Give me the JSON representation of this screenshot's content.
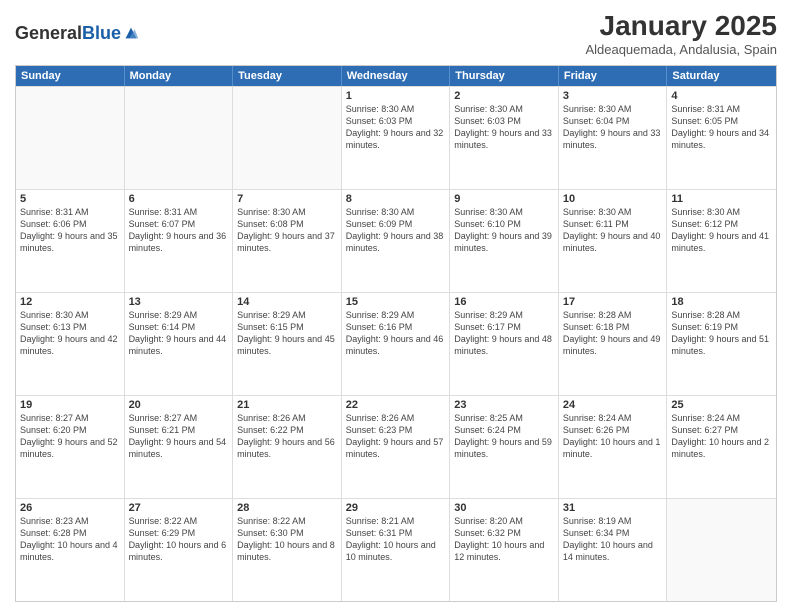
{
  "logo": {
    "general": "General",
    "blue": "Blue"
  },
  "header": {
    "month": "January 2025",
    "location": "Aldeaquemada, Andalusia, Spain"
  },
  "weekdays": [
    "Sunday",
    "Monday",
    "Tuesday",
    "Wednesday",
    "Thursday",
    "Friday",
    "Saturday"
  ],
  "weeks": [
    [
      {
        "day": "",
        "sunrise": "",
        "sunset": "",
        "daylight": ""
      },
      {
        "day": "",
        "sunrise": "",
        "sunset": "",
        "daylight": ""
      },
      {
        "day": "",
        "sunrise": "",
        "sunset": "",
        "daylight": ""
      },
      {
        "day": "1",
        "sunrise": "Sunrise: 8:30 AM",
        "sunset": "Sunset: 6:03 PM",
        "daylight": "Daylight: 9 hours and 32 minutes."
      },
      {
        "day": "2",
        "sunrise": "Sunrise: 8:30 AM",
        "sunset": "Sunset: 6:03 PM",
        "daylight": "Daylight: 9 hours and 33 minutes."
      },
      {
        "day": "3",
        "sunrise": "Sunrise: 8:30 AM",
        "sunset": "Sunset: 6:04 PM",
        "daylight": "Daylight: 9 hours and 33 minutes."
      },
      {
        "day": "4",
        "sunrise": "Sunrise: 8:31 AM",
        "sunset": "Sunset: 6:05 PM",
        "daylight": "Daylight: 9 hours and 34 minutes."
      }
    ],
    [
      {
        "day": "5",
        "sunrise": "Sunrise: 8:31 AM",
        "sunset": "Sunset: 6:06 PM",
        "daylight": "Daylight: 9 hours and 35 minutes."
      },
      {
        "day": "6",
        "sunrise": "Sunrise: 8:31 AM",
        "sunset": "Sunset: 6:07 PM",
        "daylight": "Daylight: 9 hours and 36 minutes."
      },
      {
        "day": "7",
        "sunrise": "Sunrise: 8:30 AM",
        "sunset": "Sunset: 6:08 PM",
        "daylight": "Daylight: 9 hours and 37 minutes."
      },
      {
        "day": "8",
        "sunrise": "Sunrise: 8:30 AM",
        "sunset": "Sunset: 6:09 PM",
        "daylight": "Daylight: 9 hours and 38 minutes."
      },
      {
        "day": "9",
        "sunrise": "Sunrise: 8:30 AM",
        "sunset": "Sunset: 6:10 PM",
        "daylight": "Daylight: 9 hours and 39 minutes."
      },
      {
        "day": "10",
        "sunrise": "Sunrise: 8:30 AM",
        "sunset": "Sunset: 6:11 PM",
        "daylight": "Daylight: 9 hours and 40 minutes."
      },
      {
        "day": "11",
        "sunrise": "Sunrise: 8:30 AM",
        "sunset": "Sunset: 6:12 PM",
        "daylight": "Daylight: 9 hours and 41 minutes."
      }
    ],
    [
      {
        "day": "12",
        "sunrise": "Sunrise: 8:30 AM",
        "sunset": "Sunset: 6:13 PM",
        "daylight": "Daylight: 9 hours and 42 minutes."
      },
      {
        "day": "13",
        "sunrise": "Sunrise: 8:29 AM",
        "sunset": "Sunset: 6:14 PM",
        "daylight": "Daylight: 9 hours and 44 minutes."
      },
      {
        "day": "14",
        "sunrise": "Sunrise: 8:29 AM",
        "sunset": "Sunset: 6:15 PM",
        "daylight": "Daylight: 9 hours and 45 minutes."
      },
      {
        "day": "15",
        "sunrise": "Sunrise: 8:29 AM",
        "sunset": "Sunset: 6:16 PM",
        "daylight": "Daylight: 9 hours and 46 minutes."
      },
      {
        "day": "16",
        "sunrise": "Sunrise: 8:29 AM",
        "sunset": "Sunset: 6:17 PM",
        "daylight": "Daylight: 9 hours and 48 minutes."
      },
      {
        "day": "17",
        "sunrise": "Sunrise: 8:28 AM",
        "sunset": "Sunset: 6:18 PM",
        "daylight": "Daylight: 9 hours and 49 minutes."
      },
      {
        "day": "18",
        "sunrise": "Sunrise: 8:28 AM",
        "sunset": "Sunset: 6:19 PM",
        "daylight": "Daylight: 9 hours and 51 minutes."
      }
    ],
    [
      {
        "day": "19",
        "sunrise": "Sunrise: 8:27 AM",
        "sunset": "Sunset: 6:20 PM",
        "daylight": "Daylight: 9 hours and 52 minutes."
      },
      {
        "day": "20",
        "sunrise": "Sunrise: 8:27 AM",
        "sunset": "Sunset: 6:21 PM",
        "daylight": "Daylight: 9 hours and 54 minutes."
      },
      {
        "day": "21",
        "sunrise": "Sunrise: 8:26 AM",
        "sunset": "Sunset: 6:22 PM",
        "daylight": "Daylight: 9 hours and 56 minutes."
      },
      {
        "day": "22",
        "sunrise": "Sunrise: 8:26 AM",
        "sunset": "Sunset: 6:23 PM",
        "daylight": "Daylight: 9 hours and 57 minutes."
      },
      {
        "day": "23",
        "sunrise": "Sunrise: 8:25 AM",
        "sunset": "Sunset: 6:24 PM",
        "daylight": "Daylight: 9 hours and 59 minutes."
      },
      {
        "day": "24",
        "sunrise": "Sunrise: 8:24 AM",
        "sunset": "Sunset: 6:26 PM",
        "daylight": "Daylight: 10 hours and 1 minute."
      },
      {
        "day": "25",
        "sunrise": "Sunrise: 8:24 AM",
        "sunset": "Sunset: 6:27 PM",
        "daylight": "Daylight: 10 hours and 2 minutes."
      }
    ],
    [
      {
        "day": "26",
        "sunrise": "Sunrise: 8:23 AM",
        "sunset": "Sunset: 6:28 PM",
        "daylight": "Daylight: 10 hours and 4 minutes."
      },
      {
        "day": "27",
        "sunrise": "Sunrise: 8:22 AM",
        "sunset": "Sunset: 6:29 PM",
        "daylight": "Daylight: 10 hours and 6 minutes."
      },
      {
        "day": "28",
        "sunrise": "Sunrise: 8:22 AM",
        "sunset": "Sunset: 6:30 PM",
        "daylight": "Daylight: 10 hours and 8 minutes."
      },
      {
        "day": "29",
        "sunrise": "Sunrise: 8:21 AM",
        "sunset": "Sunset: 6:31 PM",
        "daylight": "Daylight: 10 hours and 10 minutes."
      },
      {
        "day": "30",
        "sunrise": "Sunrise: 8:20 AM",
        "sunset": "Sunset: 6:32 PM",
        "daylight": "Daylight: 10 hours and 12 minutes."
      },
      {
        "day": "31",
        "sunrise": "Sunrise: 8:19 AM",
        "sunset": "Sunset: 6:34 PM",
        "daylight": "Daylight: 10 hours and 14 minutes."
      },
      {
        "day": "",
        "sunrise": "",
        "sunset": "",
        "daylight": ""
      }
    ]
  ]
}
